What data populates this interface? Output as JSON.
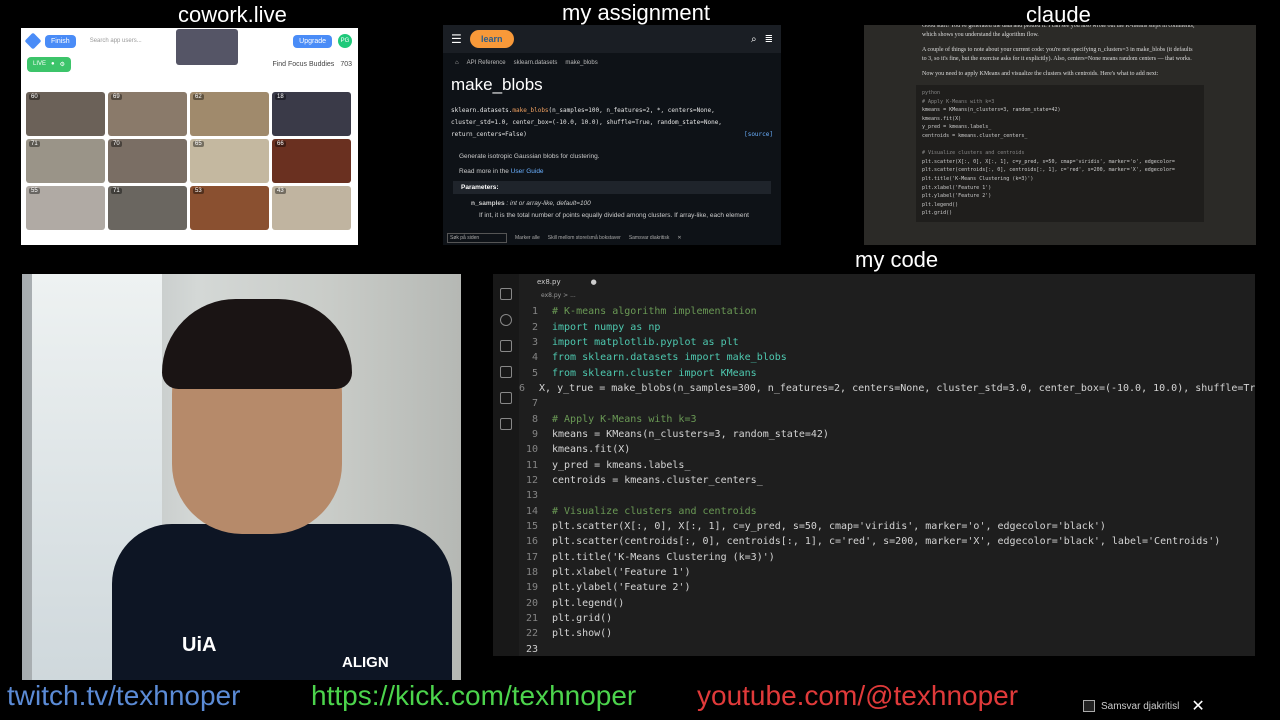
{
  "labels": {
    "cowork": "cowork.live",
    "assignment": "my assignment",
    "claude": "claude",
    "code": "my code"
  },
  "cowork": {
    "finish_label": "Finish",
    "search_placeholder": "Search app users...",
    "upgrade_label": "Upgrade",
    "avatar_initials": "PG",
    "live_label": "LIVE",
    "find_label": "Find Focus Buddies",
    "user_count": "703",
    "tiles": [
      {
        "count": "60",
        "color": "#6b6158"
      },
      {
        "count": "69",
        "color": "#8a7a6a"
      },
      {
        "count": "62",
        "color": "#a08a6c"
      },
      {
        "count": "18",
        "color": "#3a3a48"
      },
      {
        "count": "71",
        "color": "#9a9488"
      },
      {
        "count": "70",
        "color": "#7a6e64"
      },
      {
        "count": "65",
        "color": "#c4b8a0"
      },
      {
        "count": "66",
        "color": "#6a3020"
      },
      {
        "count": "55",
        "color": "#b0aaa4"
      },
      {
        "count": "71",
        "color": "#6a6660"
      },
      {
        "count": "53",
        "color": "#8a5030"
      },
      {
        "count": "43",
        "color": "#c0b4a0"
      }
    ]
  },
  "assignment": {
    "logo": "learn",
    "crumbs": [
      "API Reference",
      "sklearn.datasets",
      "make_blobs"
    ],
    "title": "make_blobs",
    "sig_prefix": "sklearn.datasets.",
    "sig_fn": "make_blobs",
    "sig_rest": "(n_samples=100, n_features=2, *, centers=None, cluster_std=1.0, center_box=(-10.0, 10.0), shuffle=True, random_state=None, return_centers=False)",
    "source": "[source]",
    "desc": "Generate isotropic Gaussian blobs for clustering.",
    "read_more_prefix": "Read more in the ",
    "read_more_link": "User Guide",
    "params_label": "Parameters:",
    "param_name": "n_samples",
    "param_type": ": int or array-like, default=100",
    "param_desc": "If int, it is the total number of points equally divided among clusters. If array-like, each element",
    "find_placeholder": "Søk på siden",
    "find_opts": [
      "Marker alle",
      "Skill mellom store/små bokstaver",
      "Samsvar diakritisk"
    ]
  },
  "claude": {
    "para1": "Good start! You've generated the data and plotted it. I can see you also wrote out the K-means steps in comments, which shows you understand the algorithm flow.",
    "para2": "A couple of things to note about your current code: you're not specifying n_clusters=3 in make_blobs (it defaults to 3, so it's fine, but the exercise asks for it explicitly). Also, centers=None means random centers — that works.",
    "para3": "Now you need to apply KMeans and visualize the clusters with centroids. Here's what to add next:",
    "code_lang": "python",
    "code_lines": [
      "# Apply K-Means with k=3",
      "kmeans = KMeans(n_clusters=3, random_state=42)",
      "kmeans.fit(X)",
      "y_pred = kmeans.labels_",
      "centroids = kmeans.cluster_centers_",
      "",
      "# Visualize clusters and centroids",
      "plt.scatter(X[:, 0], X[:, 1], c=y_pred, s=50, cmap='viridis', marker='o', edgecolor=",
      "plt.scatter(centroids[:, 0], centroids[:, 1], c='red', s=200, marker='X', edgecolor=",
      "plt.title('K-Means Clustering (k=3)')",
      "plt.xlabel('Feature 1')",
      "plt.ylabel('Feature 2')",
      "plt.legend()",
      "plt.grid()"
    ]
  },
  "editor": {
    "tab": "ex8.py",
    "crumb": "ex8.py > ...",
    "lines": [
      {
        "n": "1",
        "t": "# K-means algorithm implementation"
      },
      {
        "n": "2",
        "t": "import numpy as np"
      },
      {
        "n": "3",
        "t": "import matplotlib.pyplot as plt"
      },
      {
        "n": "4",
        "t": "from sklearn.datasets import make_blobs"
      },
      {
        "n": "5",
        "t": "from sklearn.cluster import KMeans"
      },
      {
        "n": "6",
        "t": "X, y_true = make_blobs(n_samples=300, n_features=2, centers=None, cluster_std=3.0, center_box=(-10.0, 10.0), shuffle=True, r"
      },
      {
        "n": "7",
        "t": ""
      },
      {
        "n": "8",
        "t": "# Apply K-Means with k=3"
      },
      {
        "n": "9",
        "t": "kmeans = KMeans(n_clusters=3, random_state=42)"
      },
      {
        "n": "10",
        "t": "kmeans.fit(X)"
      },
      {
        "n": "11",
        "t": "y_pred = kmeans.labels_"
      },
      {
        "n": "12",
        "t": "centroids = kmeans.cluster_centers_"
      },
      {
        "n": "13",
        "t": ""
      },
      {
        "n": "14",
        "t": "# Visualize clusters and centroids"
      },
      {
        "n": "15",
        "t": "plt.scatter(X[:, 0], X[:, 1], c=y_pred, s=50, cmap='viridis', marker='o', edgecolor='black')"
      },
      {
        "n": "16",
        "t": "plt.scatter(centroids[:, 0], centroids[:, 1], c='red', s=200, marker='X', edgecolor='black', label='Centroids')"
      },
      {
        "n": "17",
        "t": "plt.title('K-Means Clustering (k=3)')"
      },
      {
        "n": "18",
        "t": "plt.xlabel('Feature 1')"
      },
      {
        "n": "19",
        "t": "plt.ylabel('Feature 2')"
      },
      {
        "n": "20",
        "t": "plt.legend()"
      },
      {
        "n": "21",
        "t": "plt.grid()"
      },
      {
        "n": "22",
        "t": "plt.show()"
      },
      {
        "n": "23",
        "t": ""
      }
    ]
  },
  "webcam": {
    "logo_left": "UiA",
    "logo_right": "ALIGN"
  },
  "footer": {
    "twitch": "twitch.tv/texhnoper",
    "kick": "https://kick.com/texhnoper",
    "youtube": "youtube.com/@texhnoper",
    "checkbox_label": "Samsvar djakritisl",
    "close": "✕"
  }
}
